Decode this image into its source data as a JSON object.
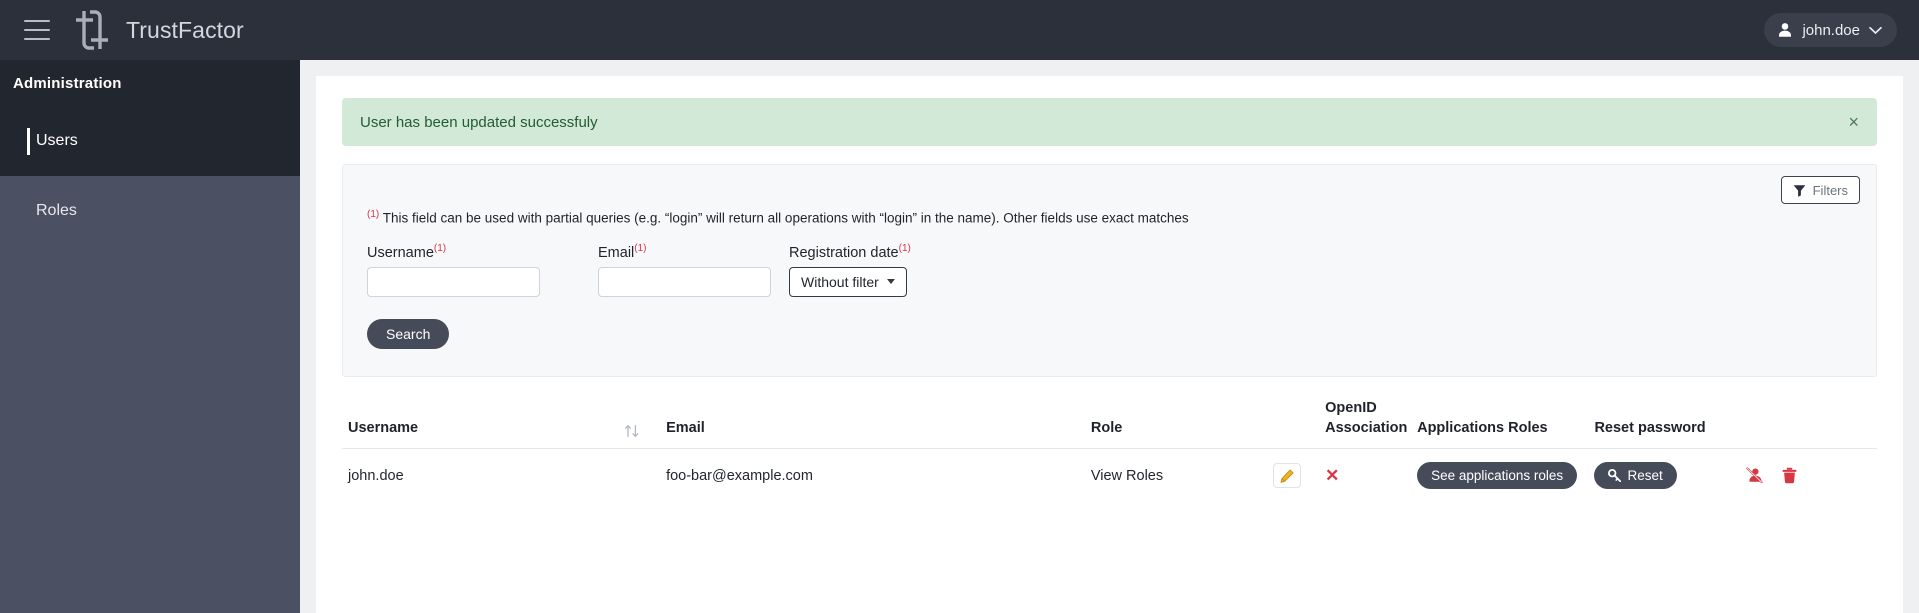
{
  "theme": {
    "topbar_bg": "#2c303a",
    "sidebar_bg": "#4b5162",
    "sidebar_active_bg": "#22262e",
    "page_bg": "#eef0f2",
    "accent_dark": "#454b59",
    "success_bg": "#d3e9d7",
    "success_text": "#215c32",
    "danger": "#dc3545",
    "edit_yellow": "#f0b323"
  },
  "topbar": {
    "menu_icon": "hamburger-icon",
    "logo_icon": "trustfactor-logo",
    "brand": "TrustFactor",
    "user": {
      "avatar_icon": "person-icon",
      "name": "john.doe",
      "chevron_icon": "chevron-down-icon"
    }
  },
  "sidebar": {
    "title": "Administration",
    "items": [
      {
        "label": "Users",
        "active": true
      },
      {
        "label": "Roles",
        "active": false
      }
    ]
  },
  "alert": {
    "message": "User has been updated successfuly",
    "close_label": "×",
    "type": "success"
  },
  "filters": {
    "toggle_label": "Filters",
    "toggle_icon": "funnel-icon",
    "hint_marker": "(1)",
    "hint_text": "This field can be used with partial queries (e.g. “login” will return all operations with “login” in the name). Other fields use exact matches",
    "fields": [
      {
        "label": "Username",
        "marker": "(1)",
        "value": "",
        "placeholder": ""
      },
      {
        "label": "Email",
        "marker": "(1)",
        "value": "",
        "placeholder": ""
      }
    ],
    "registration_date": {
      "label": "Registration date",
      "marker": "(1)",
      "selected": "Without filter",
      "chevron_icon": "caret-down-icon"
    },
    "search_label": "Search"
  },
  "table": {
    "headers": {
      "username": "Username",
      "sort_icon": "sort-updown-icon",
      "email": "Email",
      "role": "Role",
      "openid_line1": "OpenID",
      "openid_line2": "Association",
      "applications_roles": "Applications Roles",
      "reset_password": "Reset password"
    },
    "rows": [
      {
        "username": "john.doe",
        "email": "foo-bar@example.com",
        "role_label": "View Roles",
        "edit_icon": "pencil-icon",
        "openid_association": "✕",
        "applications_roles_label": "See applications roles",
        "reset_label": "Reset",
        "reset_icon": "key-icon",
        "actions": [
          {
            "icon": "user-slash-icon"
          },
          {
            "icon": "trash-icon"
          }
        ]
      }
    ]
  }
}
